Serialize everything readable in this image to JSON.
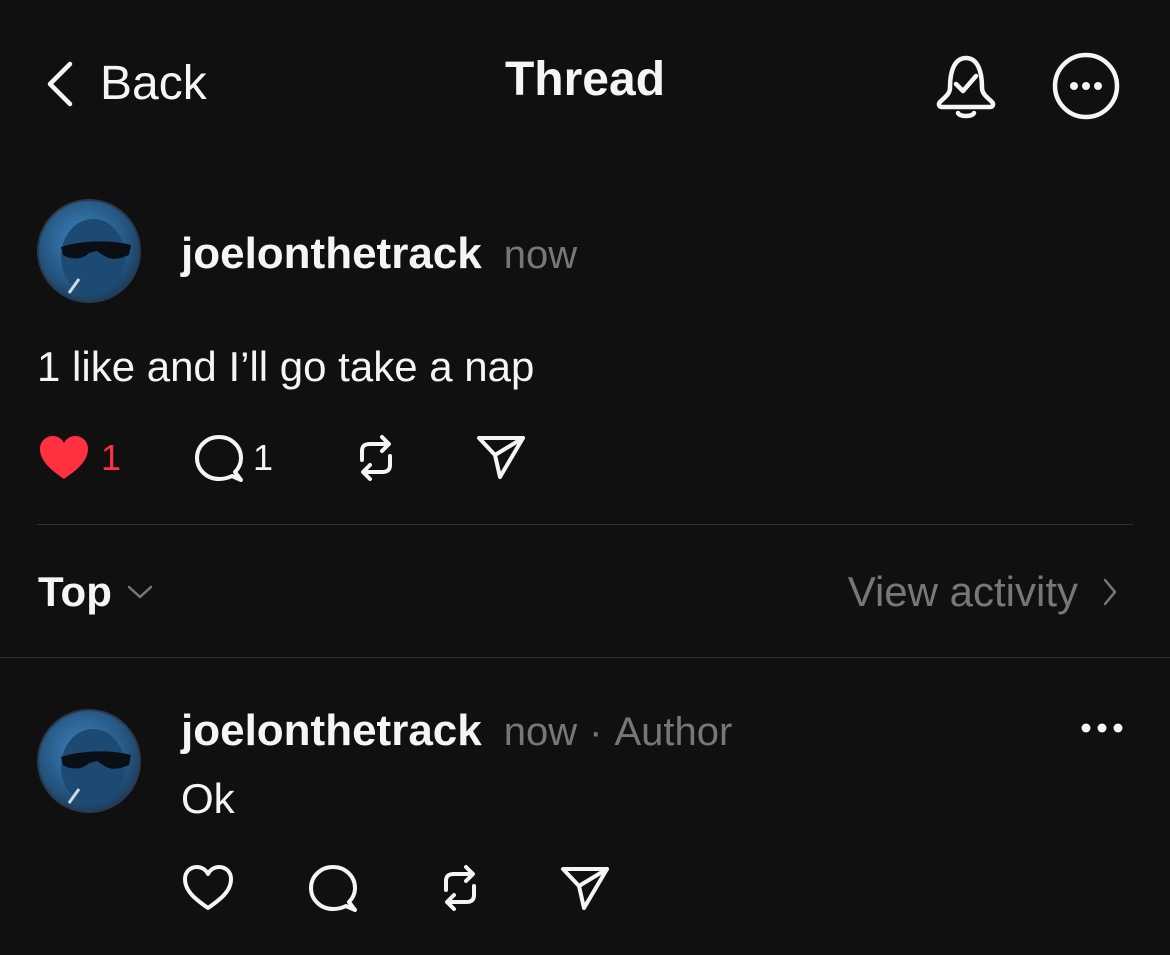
{
  "header": {
    "back_label": "Back",
    "title": "Thread",
    "icons": [
      "chevron-left-icon",
      "bell-check-icon",
      "more-circle-icon"
    ]
  },
  "post": {
    "username": "joelonthetrack",
    "time": "now",
    "text": "1 like and I’ll go take a nap",
    "likes": "1",
    "replies": "1",
    "liked": true,
    "like_color": "#ff3040"
  },
  "sort_bar": {
    "sort_label": "Top",
    "view_activity_label": "View activity"
  },
  "reply": {
    "username": "joelonthetrack",
    "time": "now",
    "separator": "·",
    "badge": "Author",
    "text": "Ok"
  }
}
